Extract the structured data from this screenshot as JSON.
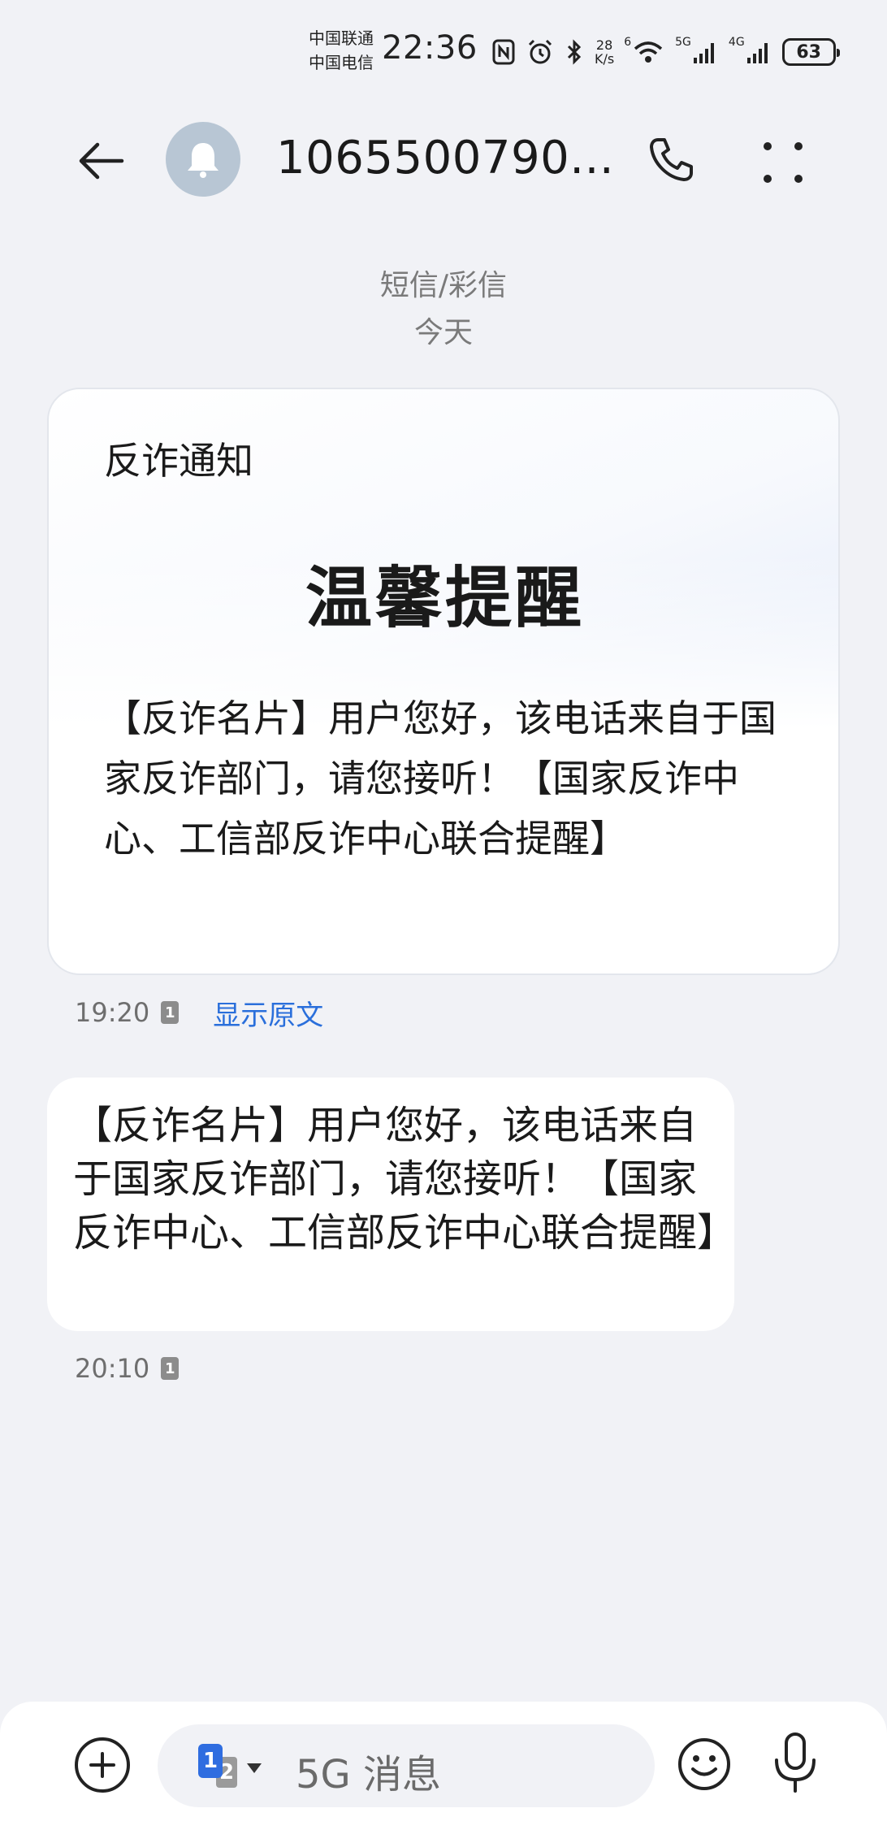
{
  "status_bar": {
    "carrier_1": "中国联通",
    "carrier_2": "中国电信",
    "time": "22:36",
    "net_speed_value": "28",
    "net_speed_unit": "K/s",
    "wifi_label": "6",
    "signal_1_label": "5G",
    "signal_2_label": "4G",
    "battery": "63"
  },
  "header": {
    "contact_name": "1065500790..."
  },
  "conversation": {
    "message_type": "短信/彩信",
    "date": "今天"
  },
  "card_message": {
    "label": "反诈通知",
    "title": "温馨提醒",
    "body": "【反诈名片】用户您好，该电话来自于国家反诈部门，请您接听！【国家反诈中心、工信部反诈中心联合提醒】",
    "time": "19:20",
    "sim": "1",
    "show_original_label": "显示原文"
  },
  "text_message": {
    "body": "【反诈名片】用户您好，该电话来自于国家反诈部门，请您接听！【国家反诈中心、工信部反诈中心联合提醒】",
    "time": "20:10",
    "sim": "1"
  },
  "composer": {
    "sim_primary": "1",
    "sim_secondary": "2",
    "placeholder": "5G 消息"
  },
  "colors": {
    "background": "#f1f2f6",
    "link": "#2a6fdb",
    "sim_blue": "#2f6de0"
  }
}
